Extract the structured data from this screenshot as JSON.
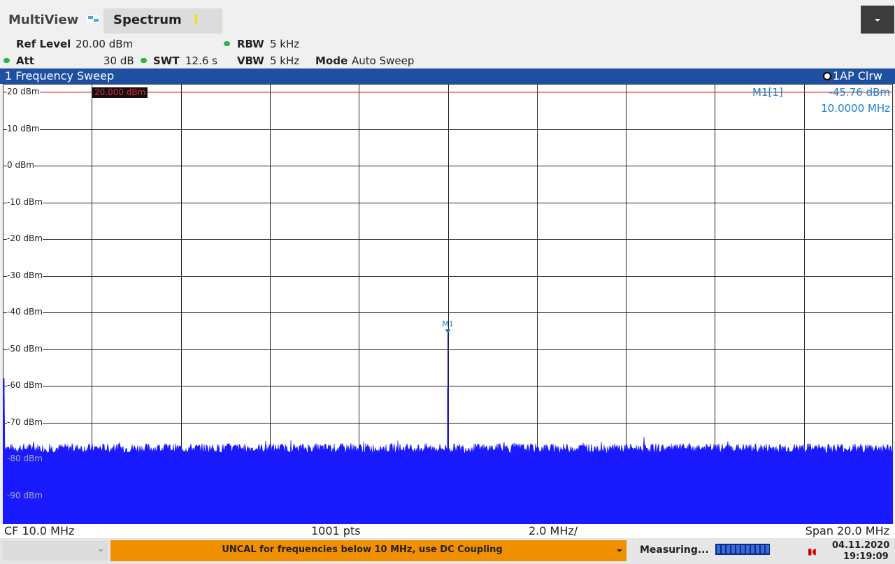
{
  "header": {
    "tab_multiview": "MultiView",
    "tab_spectrum": "Spectrum",
    "warning_symbol": "!"
  },
  "settings": {
    "ref_level_label": "Ref Level",
    "ref_level_value": "20.00 dBm",
    "att_label": "Att",
    "att_value": "30 dB",
    "swt_label": "SWT",
    "swt_value": "12.6 s",
    "rbw_label": "RBW",
    "rbw_value": "5 kHz",
    "vbw_label": "VBW",
    "vbw_value": "5 kHz",
    "mode_label": "Mode",
    "mode_value": "Auto Sweep"
  },
  "panel": {
    "title": "1 Frequency Sweep",
    "trace_info": "1AP Clrw"
  },
  "marker": {
    "name": "M1[1]",
    "level": "-45.76 dBm",
    "frequency": "10.0000 MHz",
    "label": "M1"
  },
  "ref_line_label": "20.000 dBm",
  "axis": {
    "cf": "CF 10.0 MHz",
    "points": "1001 pts",
    "div": "2.0 MHz/",
    "span": "Span 20.0 MHz"
  },
  "status": {
    "uncal_message": "UNCAL for frequencies below 10 MHz, use DC Coupling",
    "measuring": "Measuring...",
    "date": "04.11.2020",
    "time": "19:19:09"
  },
  "colors": {
    "trace": "#1a1aff",
    "marker": "#1a7fd0",
    "ref_line": "#cc2222",
    "title_bar": "#1e4fa0",
    "uncal_bar": "#f09000"
  },
  "chart_data": {
    "type": "line",
    "xlabel": "",
    "ylabel": "",
    "x_range_mhz": [
      0,
      20
    ],
    "ylim": [
      -100,
      20
    ],
    "y_ticks": [
      "20 dBm",
      "10 dBm",
      "0 dBm",
      "-10 dBm",
      "-20 dBm",
      "-30 dBm",
      "-40 dBm",
      "-50 dBm",
      "-60 dBm",
      "-70 dBm",
      "-80 dBm",
      "-90 dBm"
    ],
    "grid": true,
    "ref_level_dbm": 20,
    "noise_floor_dbm": -78,
    "peak": {
      "x_mhz": 10.0,
      "y_dbm": -45.76
    },
    "points": 1001
  }
}
